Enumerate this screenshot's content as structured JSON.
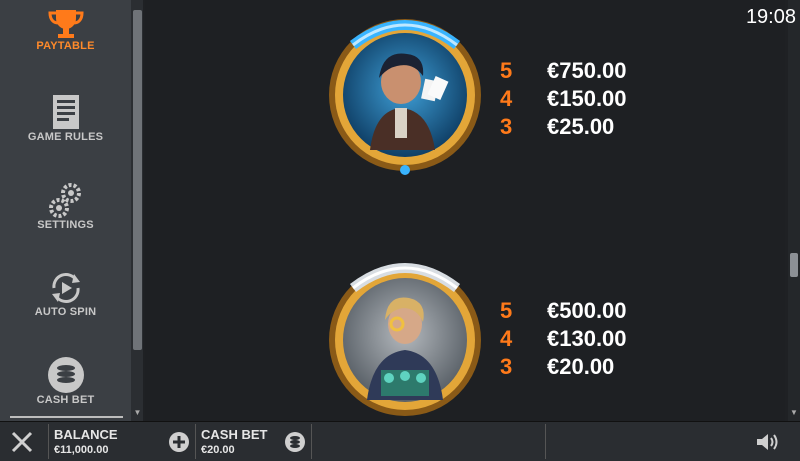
{
  "sidebar": {
    "items": [
      {
        "label": "PAYTABLE",
        "icon": "trophy-icon"
      },
      {
        "label": "GAME RULES",
        "icon": "document-icon"
      },
      {
        "label": "SETTINGS",
        "icon": "gears-icon"
      },
      {
        "label": "AUTO SPIN",
        "icon": "autospin-icon"
      },
      {
        "label": "CASH BET",
        "icon": "coins-icon"
      }
    ]
  },
  "clock": "19:08",
  "paytable": [
    {
      "symbol": "gambler-with-cards",
      "payouts": [
        {
          "count": "5",
          "amount": "€750.00"
        },
        {
          "count": "4",
          "amount": "€150.00"
        },
        {
          "count": "3",
          "amount": "€25.00"
        }
      ]
    },
    {
      "symbol": "blonde-player-with-monocle",
      "payouts": [
        {
          "count": "5",
          "amount": "€500.00"
        },
        {
          "count": "4",
          "amount": "€130.00"
        },
        {
          "count": "3",
          "amount": "€20.00"
        }
      ]
    }
  ],
  "bottom": {
    "balance_label": "BALANCE",
    "balance_value": "€11,000.00",
    "cashbet_label": "CASH BET",
    "cashbet_value": "€20.00"
  },
  "colors": {
    "accent": "#ff7a1a",
    "sidebar_bg": "#3b3f44",
    "main_bg": "#1e2023"
  }
}
